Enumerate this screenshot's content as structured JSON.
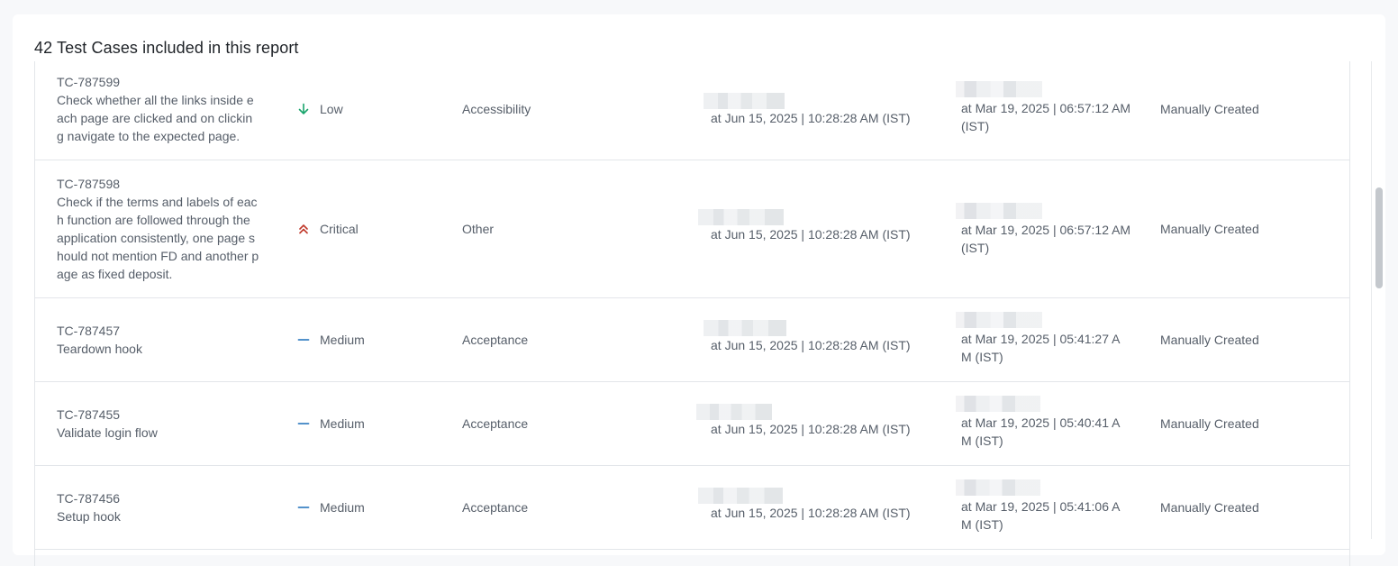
{
  "report": {
    "title": "42 Test Cases included in this report"
  },
  "rows": [
    {
      "id": "TC-787599",
      "description": "Check whether all the links inside e\nach page are clicked and on clickin\ng navigate to the expected page.",
      "priority": "Low",
      "priority_icon": "arrow-down-icon",
      "type": "Accessibility",
      "created": "at Jun 15, 2025 | 10:28:28 AM (IST)",
      "updated": "at Mar 19, 2025 | 06:57:12 AM\n(IST)",
      "source": "Manually Created"
    },
    {
      "id": "TC-787598",
      "description": "Check if the terms and labels of eac\nh function are followed through the\napplication consistently, one page s\nhould not mention FD and another p\nage as fixed deposit.",
      "priority": "Critical",
      "priority_icon": "double-chevron-up-icon",
      "type": "Other",
      "created": "at Jun 15, 2025 | 10:28:28 AM (IST)",
      "updated": "at Mar 19, 2025 | 06:57:12 AM\n(IST)",
      "source": "Manually Created"
    },
    {
      "id": "TC-787457",
      "description": "Teardown hook",
      "priority": "Medium",
      "priority_icon": "dash-icon",
      "type": "Acceptance",
      "created": "at Jun 15, 2025 | 10:28:28 AM (IST)",
      "updated": "at Mar 19, 2025 | 05:41:27 A\nM (IST)",
      "source": "Manually Created"
    },
    {
      "id": "TC-787455",
      "description": "Validate login flow",
      "priority": "Medium",
      "priority_icon": "dash-icon",
      "type": "Acceptance",
      "created": "at Jun 15, 2025 | 10:28:28 AM (IST)",
      "updated": "at Mar 19, 2025 | 05:40:41 A\nM (IST)",
      "source": "Manually Created"
    },
    {
      "id": "TC-787456",
      "description": "Setup hook",
      "priority": "Medium",
      "priority_icon": "dash-icon",
      "type": "Acceptance",
      "created": "at Jun 15, 2025 | 10:28:28 AM (IST)",
      "updated": "at Mar 19, 2025 | 05:41:06 A\nM (IST)",
      "source": "Manually Created"
    }
  ],
  "colors": {
    "low": "#18a46b",
    "critical": "#c0392b",
    "medium": "#3b82c4"
  }
}
